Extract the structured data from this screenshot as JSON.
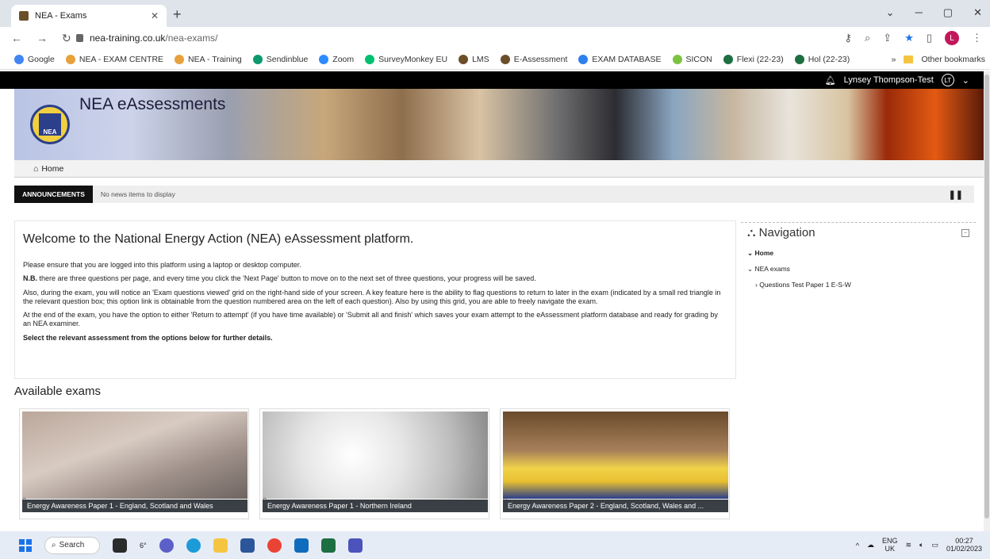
{
  "browser": {
    "tab_title": "NEA - Exams",
    "new_tab": "+",
    "url_host": "nea-training.co.uk",
    "url_path": "/nea-exams/",
    "profile_initial": "L",
    "bookmarks": [
      {
        "label": "Google",
        "color": "#4285f4"
      },
      {
        "label": "NEA - EXAM CENTRE",
        "color": "#e8a13a"
      },
      {
        "label": "NEA - Training",
        "color": "#e8a13a"
      },
      {
        "label": "Sendinblue",
        "color": "#0b996e"
      },
      {
        "label": "Zoom",
        "color": "#2d8cff"
      },
      {
        "label": "SurveyMonkey EU",
        "color": "#00bf6f"
      },
      {
        "label": "LMS",
        "color": "#6b4f2a"
      },
      {
        "label": "E-Assessment",
        "color": "#6b4f2a"
      },
      {
        "label": "EXAM DATABASE",
        "color": "#2f80ed"
      },
      {
        "label": "SICON",
        "color": "#7cc242"
      },
      {
        "label": "Flexi (22-23)",
        "color": "#1d6f42"
      },
      {
        "label": "Hol (22-23)",
        "color": "#1d6f42"
      }
    ],
    "more_bookmarks": "»",
    "other_bookmarks": "Other bookmarks"
  },
  "site": {
    "user_name": "Lynsey Thompson-Test",
    "user_initials": "LT",
    "banner_title": "NEA eAssessments",
    "logo_text": "NEA",
    "breadcrumb_home": "Home",
    "announcements_label": "ANNOUNCEMENTS",
    "announcements_msg": "No news items to display",
    "pause_symbol": "❚❚"
  },
  "welcome": {
    "heading": "Welcome to the National Energy Action (NEA) eAssessment platform.",
    "p1": "Please ensure that you are logged into this platform using a laptop or desktop computer.",
    "p2_bold": "N.B.",
    "p2": " there are three questions per page, and every time you click the 'Next Page' button to move on to the next set of three questions, your progress will be saved.",
    "p3": "Also, during the exam, you will notice an 'Exam questions viewed' grid on the right-hand side of your screen. A key feature here is the ability to flag questions to return to later in the exam (indicated by a small red triangle in the relevant question box; this option link is obtainable from the question numbered area on the left of each question). Also by using this grid, you are able to freely navigate the exam.",
    "p4": "At the end of the exam, you have the option to either 'Return to attempt' (if you have time available) or 'Submit all and finish' which saves your exam attempt to the eAssessment platform database and ready for grading by an NEA examiner.",
    "p5": "Select the relevant assessment from the options below for further details."
  },
  "navigation": {
    "title": "Navigation",
    "items": [
      {
        "label": "Home",
        "prefix": "⌄",
        "bold": true
      },
      {
        "label": "NEA exams",
        "prefix": "⌄",
        "bold": false
      },
      {
        "label": "Questions Test Paper 1 E-S-W",
        "prefix": "›",
        "bold": false
      }
    ]
  },
  "exams": {
    "heading": "Available exams",
    "cards": [
      {
        "caption": "Energy Awareness Paper 1 - England, Scotland and Wales"
      },
      {
        "caption": "Energy Awareness Paper 1 - Northern Ireland"
      },
      {
        "caption": "Energy Awareness Paper 2 - England, Scotland, Wales and ..."
      }
    ]
  },
  "taskbar": {
    "search": "Search",
    "temp": "6°",
    "lang": "ENG",
    "region": "UK",
    "time": "00:27",
    "date": "01/02/2023"
  }
}
